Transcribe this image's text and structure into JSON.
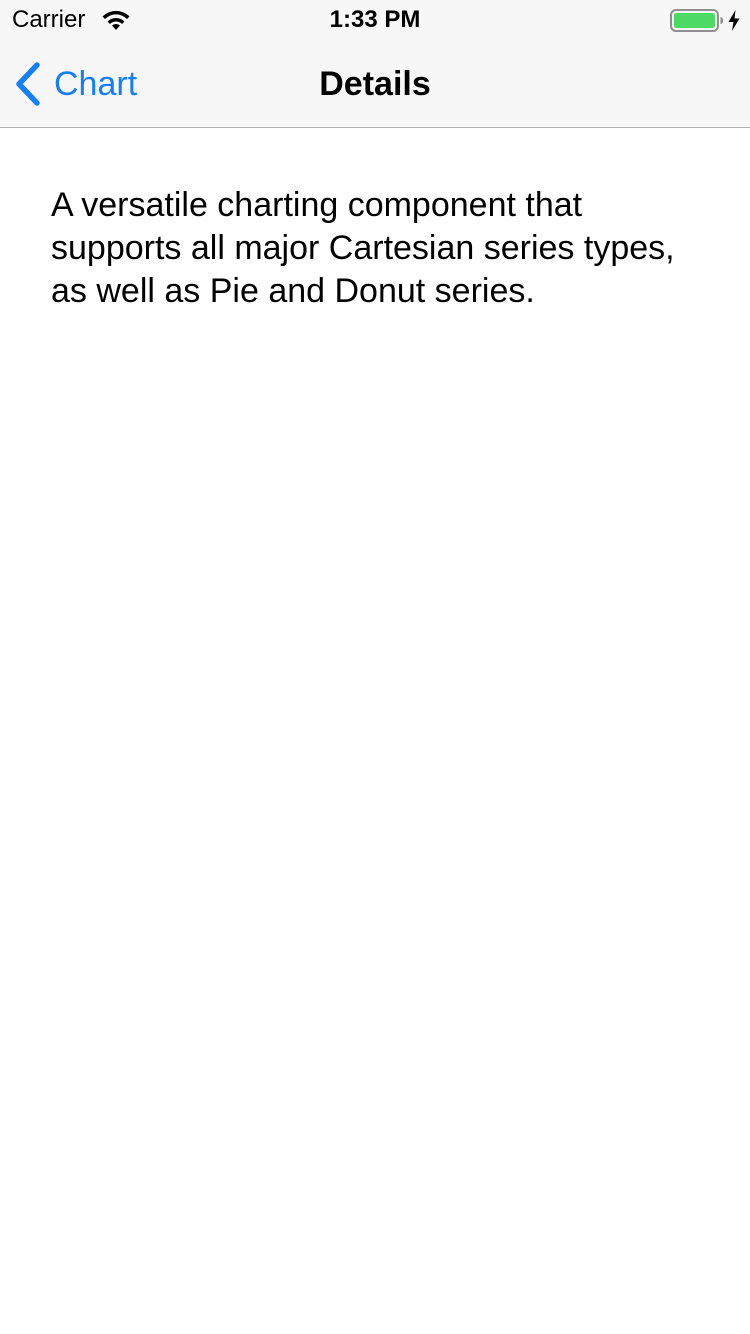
{
  "status_bar": {
    "carrier": "Carrier",
    "time": "1:33 PM",
    "wifi_icon": "wifi-icon",
    "battery_icon": "battery-icon",
    "charging_icon": "charging-bolt-icon",
    "battery_color": "#4cd964"
  },
  "nav": {
    "back_label": "Chart",
    "back_icon": "chevron-left-icon",
    "title": "Details",
    "accent_color": "#157efb"
  },
  "content": {
    "description": "A versatile charting component that supports all major Cartesian series types, as well as Pie and Donut series."
  }
}
